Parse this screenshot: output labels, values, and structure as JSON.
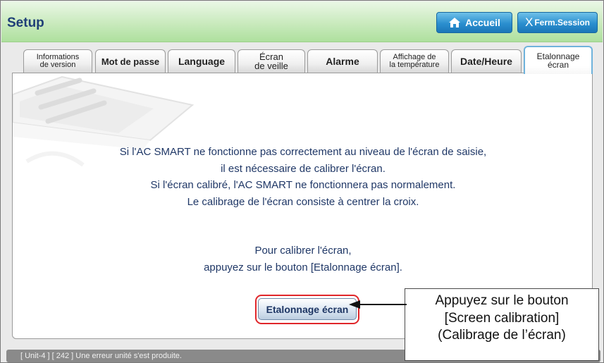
{
  "header": {
    "title": "Setup",
    "home_label": "Accueil",
    "logout_label": "Ferm.Session"
  },
  "tabs": [
    {
      "line1": "Informations",
      "line2": "de version"
    },
    {
      "line1": "Mot de passe",
      "line2": ""
    },
    {
      "line1": "Language",
      "line2": ""
    },
    {
      "line1": "Écran",
      "line2": "de veille"
    },
    {
      "line1": "Alarme",
      "line2": ""
    },
    {
      "line1": "Affichage de",
      "line2": "la température"
    },
    {
      "line1": "Date/Heure",
      "line2": ""
    },
    {
      "line1": "Etalonnage",
      "line2": "écran",
      "active": true
    }
  ],
  "message": {
    "line1": "Si l'AC SMART ne fonctionne pas correctement au niveau de l'écran de saisie,",
    "line2": "il est nécessaire de calibrer l'écran.",
    "line3": "Si l'écran calibré, l'AC SMART ne fonctionnera pas normalement.",
    "line4": "Le calibrage de l'écran consiste à centrer la croix.",
    "line5": "Pour calibrer l'écran,",
    "line6": "appuyez sur le bouton [Etalonnage écran]."
  },
  "calibration_button_label": "Etalonnage écran",
  "status_bar": "[ Unit-4 ] [ 242 ] Une erreur unité s'est produite.",
  "callout": {
    "line1": "Appuyez sur le bouton",
    "line2": "[Screen calibration]",
    "line3": "(Calibrage de l’écran)"
  },
  "colors": {
    "header_green": "#c9eabd",
    "title_blue": "#1f3f77",
    "button_blue": "#2b8fcf",
    "highlight_red": "#e0262a",
    "active_tab_border": "#6fb3dc"
  },
  "icons": {
    "home": "home-icon",
    "logout": "x-close-icon"
  }
}
